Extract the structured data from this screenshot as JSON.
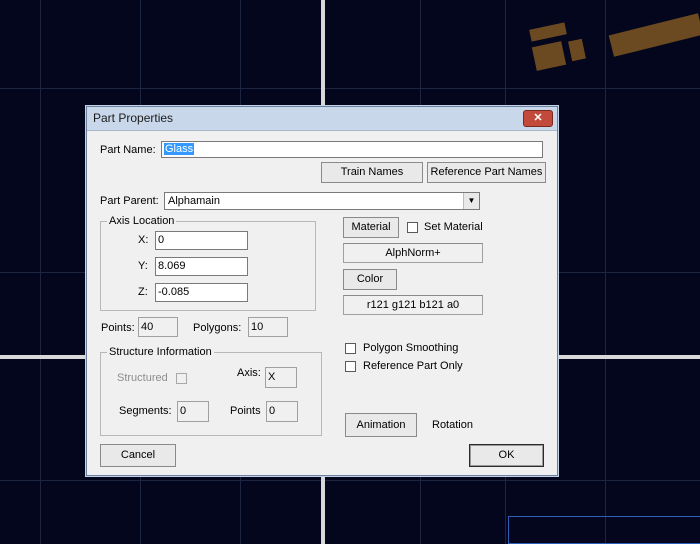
{
  "dialog": {
    "title": "Part Properties",
    "close_glyph": "✕",
    "part_name_label": "Part Name:",
    "part_name_value": "Glass",
    "train_names_button": "Train Names",
    "reference_part_names_button": "Reference Part Names",
    "part_parent_label": "Part Parent:",
    "part_parent_value": "Alphamain",
    "axis_location": {
      "title": "Axis Location",
      "x_label": "X:",
      "x_value": "0",
      "y_label": "Y:",
      "y_value": "8.069",
      "z_label": "Z:",
      "z_value": "-0.085"
    },
    "material_button": "Material",
    "set_material_label": "Set Material",
    "material_value": "AlphNorm+",
    "color_button": "Color",
    "color_value": "r121 g121 b121 a0",
    "points_label": "Points:",
    "points_value": "40",
    "polygons_label": "Polygons:",
    "polygons_value": "10",
    "polygon_smoothing_label": "Polygon Smoothing",
    "reference_part_only_label": "Reference Part Only",
    "structure": {
      "title": "Structure Information",
      "structured_label": "Structured",
      "axis_label": "Axis:",
      "axis_value": "X",
      "segments_label": "Segments:",
      "segments_value": "0",
      "points_label": "Points",
      "points_value": "0"
    },
    "animation_button": "Animation",
    "rotation_label": "Rotation",
    "cancel_button": "Cancel",
    "ok_button": "OK"
  },
  "colors": {
    "viewport_bg": "#03061c",
    "grid": "#1d2540",
    "axis": "#d8d8d8",
    "model": "#6b4a22",
    "selection": "#3399ff"
  }
}
